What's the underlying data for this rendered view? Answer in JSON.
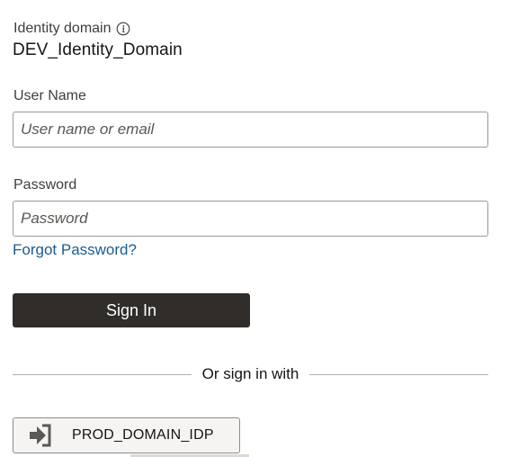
{
  "identity_domain": {
    "label": "Identity domain",
    "value": "DEV_Identity_Domain",
    "info_icon": "info-icon"
  },
  "username": {
    "label": "User Name",
    "placeholder": "User name or email",
    "value": ""
  },
  "password": {
    "label": "Password",
    "placeholder": "Password",
    "value": ""
  },
  "forgot_password": {
    "label": "Forgot Password?"
  },
  "sign_in": {
    "label": "Sign In"
  },
  "alt_sign_in": {
    "divider_text": "Or sign in with",
    "providers": [
      {
        "label": "PROD_DOMAIN_IDP",
        "icon": "sign-in-arrow-icon"
      }
    ]
  },
  "colors": {
    "primary_button": "#312d2a",
    "link": "#1a5c91",
    "input_border": "#9e9892"
  }
}
